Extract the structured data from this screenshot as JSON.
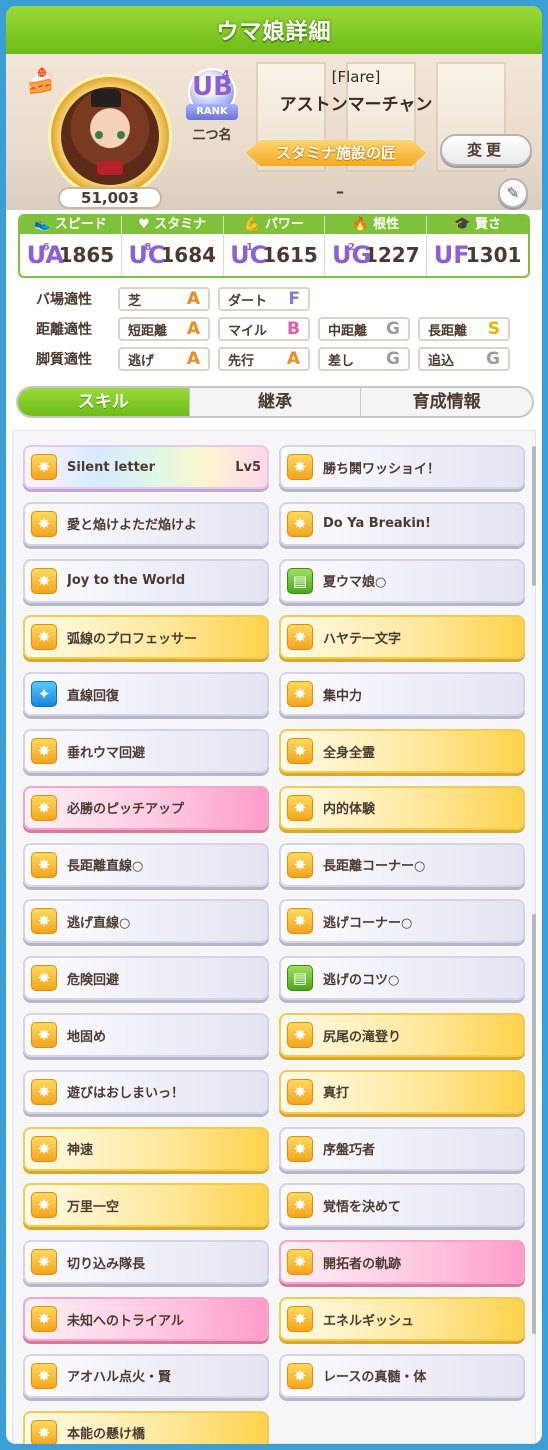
{
  "header": {
    "title": "ウマ娘詳細"
  },
  "profile": {
    "epithet": "[Flare]",
    "name": "アストンマーチャン",
    "rank": {
      "grade": "UB",
      "sub": "4",
      "label": "RANK"
    },
    "nickname_label": "二つ名",
    "title": "スタミナ施設の匠",
    "change_label": "変更",
    "subtitle": "–",
    "points": "51,003"
  },
  "stats": [
    {
      "label": "スピード",
      "icon": "shoe-icon",
      "grade": "UA",
      "num": "6",
      "value": "1865"
    },
    {
      "label": "スタミナ",
      "icon": "heart-icon",
      "grade": "UC",
      "num": "8",
      "value": "1684"
    },
    {
      "label": "パワー",
      "icon": "arm-icon",
      "grade": "UC",
      "num": "1",
      "value": "1615"
    },
    {
      "label": "根性",
      "icon": "flame-icon",
      "grade": "UG",
      "num": "2",
      "value": "1227"
    },
    {
      "label": "賢さ",
      "icon": "cap-icon",
      "grade": "UF",
      "num": "",
      "value": "1301"
    }
  ],
  "aptitudes": {
    "field": {
      "label": "バ場適性",
      "items": [
        {
          "name": "芝",
          "grade": "A"
        },
        {
          "name": "ダート",
          "grade": "F"
        }
      ]
    },
    "distance": {
      "label": "距離適性",
      "items": [
        {
          "name": "短距離",
          "grade": "A"
        },
        {
          "name": "マイル",
          "grade": "B"
        },
        {
          "name": "中距離",
          "grade": "G"
        },
        {
          "name": "長距離",
          "grade": "S"
        }
      ]
    },
    "style": {
      "label": "脚質適性",
      "items": [
        {
          "name": "逃げ",
          "grade": "A"
        },
        {
          "name": "先行",
          "grade": "A"
        },
        {
          "name": "差し",
          "grade": "G"
        },
        {
          "name": "追込",
          "grade": "G"
        }
      ]
    }
  },
  "colors": {
    "A": "#f08a1f",
    "B": "#e85aa9",
    "F": "#8a7bd9",
    "G": "#9c9c9c",
    "S": "#e8b100",
    "accent": "#6cbc18"
  },
  "tabs": [
    "スキル",
    "継承",
    "育成情報"
  ],
  "skills": [
    {
      "name": "Silent letter",
      "lv": "Lv5",
      "style": "rainbow",
      "icon": "skill-icon"
    },
    {
      "name": "勝ち鬨ワッショイ！",
      "lv": "",
      "style": "plain",
      "icon": "skill-icon"
    },
    {
      "name": "愛と焔けよただ焔けよ",
      "lv": "",
      "style": "plain",
      "icon": "skill-icon"
    },
    {
      "name": "Do Ya Breakin!",
      "lv": "",
      "style": "plain",
      "icon": "skill-icon"
    },
    {
      "name": "Joy to the World",
      "lv": "",
      "style": "plain",
      "icon": "skill-icon"
    },
    {
      "name": "夏ウマ娘○",
      "lv": "",
      "style": "plain",
      "icon": "green-icon"
    },
    {
      "name": "弧線のプロフェッサー",
      "lv": "",
      "style": "gold",
      "icon": "skill-icon"
    },
    {
      "name": "ハヤテ一文字",
      "lv": "",
      "style": "gold",
      "icon": "skill-icon"
    },
    {
      "name": "直線回復",
      "lv": "",
      "style": "plain",
      "icon": "blue-icon"
    },
    {
      "name": "集中力",
      "lv": "",
      "style": "plain",
      "icon": "skill-icon"
    },
    {
      "name": "垂れウマ回避",
      "lv": "",
      "style": "plain",
      "icon": "skill-icon"
    },
    {
      "name": "全身全霊",
      "lv": "",
      "style": "gold",
      "icon": "skill-icon"
    },
    {
      "name": "必勝のピッチアップ",
      "lv": "",
      "style": "pink",
      "icon": "skill-icon"
    },
    {
      "name": "内的体験",
      "lv": "",
      "style": "gold",
      "icon": "skill-icon"
    },
    {
      "name": "長距離直線○",
      "lv": "",
      "style": "plain",
      "icon": "skill-icon"
    },
    {
      "name": "長距離コーナー○",
      "lv": "",
      "style": "plain",
      "icon": "skill-icon"
    },
    {
      "name": "逃げ直線○",
      "lv": "",
      "style": "plain",
      "icon": "skill-icon"
    },
    {
      "name": "逃げコーナー○",
      "lv": "",
      "style": "plain",
      "icon": "skill-icon"
    },
    {
      "name": "危険回避",
      "lv": "",
      "style": "plain",
      "icon": "skill-icon"
    },
    {
      "name": "逃げのコツ○",
      "lv": "",
      "style": "plain",
      "icon": "green-icon"
    },
    {
      "name": "地固め",
      "lv": "",
      "style": "plain",
      "icon": "skill-icon"
    },
    {
      "name": "尻尾の滝登り",
      "lv": "",
      "style": "gold",
      "icon": "skill-icon"
    },
    {
      "name": "遊びはおしまいっ！",
      "lv": "",
      "style": "plain",
      "icon": "skill-icon"
    },
    {
      "name": "真打",
      "lv": "",
      "style": "gold",
      "icon": "skill-icon"
    },
    {
      "name": "神速",
      "lv": "",
      "style": "gold",
      "icon": "skill-icon"
    },
    {
      "name": "序盤巧者",
      "lv": "",
      "style": "plain",
      "icon": "skill-icon"
    },
    {
      "name": "万里一空",
      "lv": "",
      "style": "gold",
      "icon": "skill-icon"
    },
    {
      "name": "覚悟を決めて",
      "lv": "",
      "style": "plain",
      "icon": "skill-icon"
    },
    {
      "name": "切り込み隊長",
      "lv": "",
      "style": "plain",
      "icon": "skill-icon"
    },
    {
      "name": "開拓者の軌跡",
      "lv": "",
      "style": "pink",
      "icon": "skill-icon"
    },
    {
      "name": "未知へのトライアル",
      "lv": "",
      "style": "pink",
      "icon": "skill-icon"
    },
    {
      "name": "エネルギッシュ",
      "lv": "",
      "style": "gold",
      "icon": "skill-icon"
    },
    {
      "name": "アオハル点火・賢",
      "lv": "",
      "style": "plain",
      "icon": "skill-icon"
    },
    {
      "name": "レースの真髄・体",
      "lv": "",
      "style": "plain",
      "icon": "skill-icon"
    },
    {
      "name": "本能の懸け橋",
      "lv": "",
      "style": "gold",
      "icon": "skill-icon"
    }
  ]
}
